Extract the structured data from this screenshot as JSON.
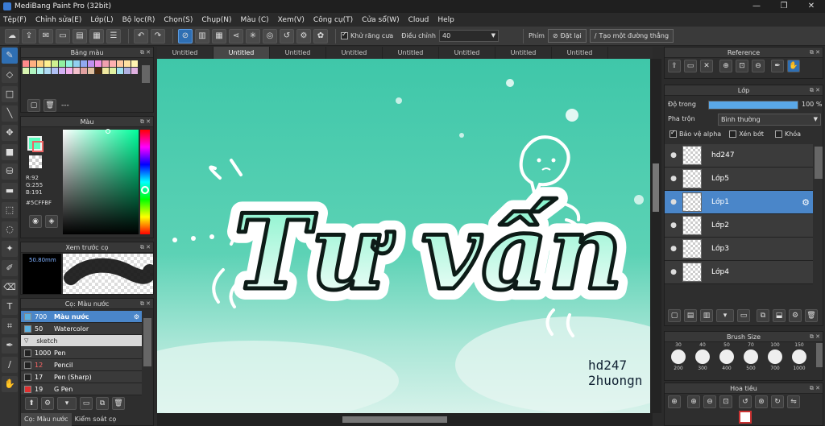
{
  "window": {
    "title": "MediBang Paint Pro (32bit)",
    "minimize": "—",
    "maximize": "❐",
    "close": "✕"
  },
  "menu": [
    "Tệp(F)",
    "Chỉnh sửa(E)",
    "Lớp(L)",
    "Bộ lọc(R)",
    "Chọn(S)",
    "Chụp(N)",
    "Màu (C)",
    "Xem(V)",
    "Công cụ(T)",
    "Cửa sổ(W)",
    "Cloud",
    "Help"
  ],
  "toolbar": {
    "antialias_label": "Khử răng cưa",
    "adjust_label": "Điều chỉnh",
    "adjust_value": "40",
    "shortcut_label": "Phím",
    "reset_label": "Đặt lại",
    "straight_line_label": "Tạo một đường thẳng"
  },
  "tabs": [
    "Untitled",
    "Untitled",
    "Untitled",
    "Untitled",
    "Untitled",
    "Untitled",
    "Untitled",
    "Untitled"
  ],
  "palette_panel": {
    "title": "Bảng màu",
    "swatches": [
      "#ff8a8a",
      "#ffb080",
      "#ffd080",
      "#fff090",
      "#d0f090",
      "#90f0a0",
      "#90f0e0",
      "#90d0f0",
      "#90a8f0",
      "#c090f0",
      "#f090e0",
      "#f0a0b0",
      "#ffb0b0",
      "#ffc8a0",
      "#ffe0a0",
      "#fff4b0",
      "#d8f4b0",
      "#b0f4c0",
      "#b0f4ec",
      "#b0dcf4",
      "#b0c0f4",
      "#d4b0f4",
      "#f4b0ec",
      "#f4c0cc",
      "#e0a0a0",
      "#e0c0a0",
      "#4a2a10",
      "#f0e8a0",
      "#e0f0a0",
      "#a0e0f0",
      "#b0b0e0",
      "#e0b0e0"
    ],
    "footer_text": "---"
  },
  "color_panel": {
    "title": "Màu",
    "r": "R:92",
    "g": "G:255",
    "b": "B:191",
    "hex": "#5CFFBF",
    "accent": "#5CFFBF"
  },
  "brush_preview": {
    "title": "Xem trước cọ",
    "size": "50.80mm"
  },
  "brush_panel": {
    "title": "Cọ: Màu nước",
    "items": [
      {
        "size": "700",
        "name": "Màu nước",
        "selected": true,
        "color": "#5ab0e0"
      },
      {
        "size": "50",
        "name": "Watercolor",
        "selected": false,
        "color": "#5ab0e0"
      },
      {
        "size": "",
        "name": "sketch",
        "group": true
      },
      {
        "size": "1000",
        "name": "Pen",
        "selected": false,
        "color": "#222"
      },
      {
        "size": "12",
        "name": "Pencil",
        "selected": false,
        "color": "#222"
      },
      {
        "size": "17",
        "name": "Pen (Sharp)",
        "selected": false,
        "color": "#222"
      },
      {
        "size": "19",
        "name": "G Pen",
        "selected": false,
        "color": "#e03030"
      }
    ]
  },
  "bottom_tabs": [
    "Cọ: Màu nước",
    "Kiểm soát cọ"
  ],
  "canvas": {
    "title_text": "Tư vấn",
    "watermark_line1": "hd247",
    "watermark_line2": "2huongn"
  },
  "reference_panel": {
    "title": "Reference"
  },
  "layer_panel": {
    "title": "Lớp",
    "opacity_label": "Độ trong",
    "opacity_value": "100 %",
    "opacity_fraction": 1.0,
    "blend_label": "Pha trộn",
    "blend_value": "Bình thường",
    "protect_alpha": "Bảo vệ alpha",
    "clip": "Xén bớt",
    "lock": "Khóa",
    "layers": [
      {
        "name": "hd247",
        "selected": false
      },
      {
        "name": "Lớp5",
        "selected": false
      },
      {
        "name": "Lớp1",
        "selected": true
      },
      {
        "name": "Lớp2",
        "selected": false
      },
      {
        "name": "Lớp3",
        "selected": false
      },
      {
        "name": "Lớp4",
        "selected": false
      }
    ]
  },
  "brush_size_panel": {
    "title": "Brush Size",
    "top_values": [
      "30",
      "40",
      "50",
      "70",
      "100",
      "150"
    ],
    "bottom_values": [
      "200",
      "300",
      "400",
      "500",
      "700",
      "1000"
    ]
  },
  "navigator_panel": {
    "title": "Hoa tiêu"
  }
}
